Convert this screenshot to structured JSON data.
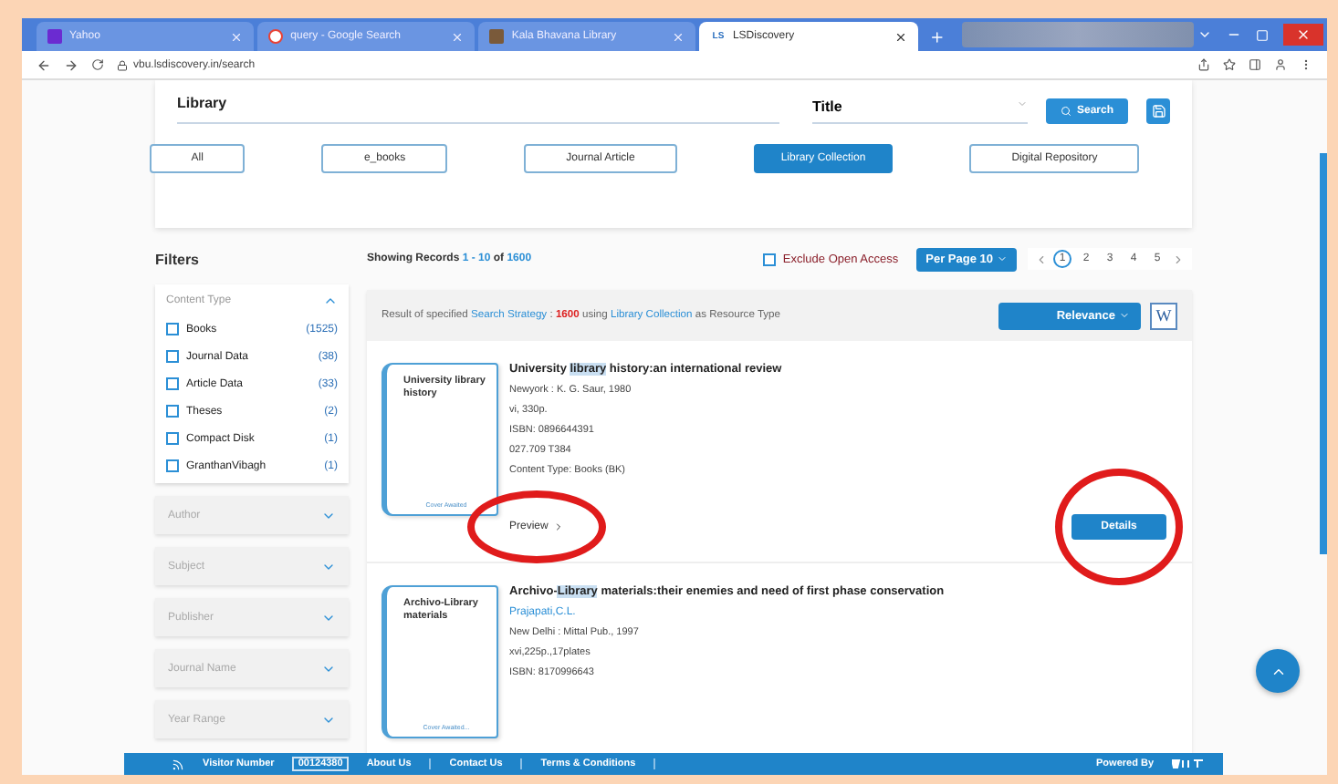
{
  "browser": {
    "tabs": [
      {
        "title": "Yahoo",
        "kind": "square",
        "selected": false
      },
      {
        "title": "query - Google Search",
        "kind": "circle",
        "selected": false
      },
      {
        "title": "Kala Bhavana Library",
        "kind": "image",
        "selected": false
      },
      {
        "title": "LSDiscovery",
        "kind": "letters",
        "icon_text": "LS",
        "selected": true
      }
    ],
    "url": "vbu.lsdiscovery.in/search"
  },
  "search": {
    "value": "Library",
    "field": "Title",
    "button": "Search"
  },
  "resource_types": [
    {
      "label": "All",
      "selected": false
    },
    {
      "label": "e_books",
      "selected": false
    },
    {
      "label": "Journal Article",
      "selected": false
    },
    {
      "label": "Library Collection",
      "selected": true
    },
    {
      "label": "Digital Repository",
      "selected": false
    }
  ],
  "filters": {
    "title": "Filters",
    "content_type": {
      "title": "Content Type",
      "expanded": true,
      "items": [
        {
          "label": "Books",
          "count": "(1525)",
          "checked": false
        },
        {
          "label": "Journal Data",
          "count": "(38)",
          "checked": false
        },
        {
          "label": "Article Data",
          "count": "(33)",
          "checked": false
        },
        {
          "label": "Theses",
          "count": "(2)",
          "checked": false
        },
        {
          "label": "Compact Disk",
          "count": "(1)",
          "checked": false
        },
        {
          "label": "GranthanVibagh",
          "count": "(1)",
          "checked": false
        }
      ]
    },
    "panels": [
      {
        "title": "Author",
        "expanded": false
      },
      {
        "title": "Subject",
        "expanded": false
      },
      {
        "title": "Publisher",
        "expanded": false
      },
      {
        "title": "Journal Name",
        "expanded": false
      },
      {
        "title": "Year Range",
        "expanded": false
      }
    ]
  },
  "results": {
    "showing": [
      {
        "text": "Showing Records",
        "kind": "plain"
      },
      {
        "text": "1 - 10",
        "kind": "link"
      },
      {
        "text": "of",
        "kind": "plain"
      },
      {
        "text": "1600",
        "kind": "link"
      }
    ],
    "exclude_open_access": {
      "label": "Exclude Open Access",
      "checked": false
    },
    "per_page": "Per Page 10",
    "pages": [
      {
        "label": "1",
        "selected": true
      },
      {
        "label": "2",
        "selected": false
      },
      {
        "label": "3",
        "selected": false
      },
      {
        "label": "4",
        "selected": false
      },
      {
        "label": "5",
        "selected": false
      }
    ],
    "strategy": [
      {
        "text": "Result of specified",
        "kind": "plain"
      },
      {
        "text": "Search Strategy",
        "kind": "link"
      },
      {
        "text": ":",
        "kind": "plain"
      },
      {
        "text": "1600",
        "kind": "count"
      },
      {
        "text": "using",
        "kind": "plain"
      },
      {
        "text": "Library Collection",
        "kind": "link"
      },
      {
        "text": "as Resource Type",
        "kind": "plain"
      }
    ],
    "sort": "Relevance",
    "wiki": "W",
    "items": [
      {
        "cover_title": "University library history",
        "cover_note": "Cover Awaited",
        "title": [
          {
            "text": "University ",
            "highlighted": false
          },
          {
            "text": "library",
            "highlighted": true
          },
          {
            "text": " history:an international review",
            "highlighted": false
          }
        ],
        "lines": [
          "Newyork : K. G. Saur, 1980",
          "vi, 330p.",
          "ISBN: 0896644391",
          "027.709 T384",
          "Content Type: Books (BK)"
        ],
        "preview": "Preview",
        "details": "Details"
      },
      {
        "cover_title": "Archivo-Library materials",
        "cover_note": "Cover Awaited...",
        "title": [
          {
            "text": "Archivo-",
            "highlighted": false
          },
          {
            "text": "Library",
            "highlighted": true
          },
          {
            "text": " materials:their enemies and need of first phase conservation",
            "highlighted": false
          }
        ],
        "author": "Prajapati,C.L.",
        "lines": [
          "New Delhi : Mittal Pub., 1997",
          "xvi,225p.,17plates",
          "ISBN: 8170996643"
        ]
      }
    ]
  },
  "footer": {
    "visitor_label": "Visitor Number",
    "visitor_count": "00124380",
    "links": [
      "About Us",
      "Contact Us",
      "Terms & Conditions"
    ],
    "powered_by": "Powered By"
  }
}
